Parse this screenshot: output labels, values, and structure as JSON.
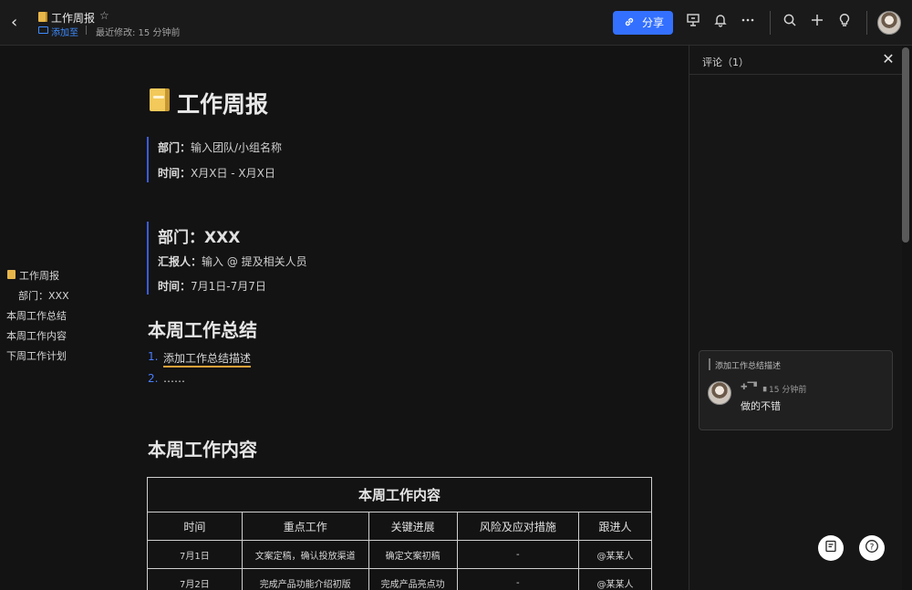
{
  "header": {
    "back_glyph": "‹",
    "title": "工作周报",
    "star_glyph": "☆",
    "add_to": "添加至",
    "modified": "最近修改: 15 分钟前",
    "share_label": "分享",
    "share_icon": "link-icon",
    "icons": [
      "presentation-icon",
      "bell-icon",
      "more-icon",
      "search-icon",
      "plus-icon",
      "lightbulb-icon"
    ]
  },
  "outline": {
    "items": [
      {
        "label": "工作周报"
      },
      {
        "label": "部门：XXX"
      },
      {
        "label": "本周工作总结"
      },
      {
        "label": "本周工作内容"
      },
      {
        "label": "下周工作计划"
      }
    ]
  },
  "doc": {
    "title": "工作周报",
    "meta": {
      "dept_label": "部门：",
      "dept_value": "输入团队/小组名称",
      "time_label": "时间：",
      "time_value": "X月X日 - X月X日"
    },
    "dept_heading": "部门：XXX",
    "reporter_label": "汇报人：",
    "reporter_value": "输入 @ 提及相关人员",
    "period_label": "时间：",
    "period_value": "7月1日-7月7日",
    "summary_heading": "本周工作总结",
    "summary_items": [
      {
        "num": "1.",
        "text": "添加工作总结描述"
      },
      {
        "num": "2.",
        "text": "……"
      }
    ],
    "content_heading": "本周工作内容",
    "table": {
      "caption": "本周工作内容",
      "headers": [
        "时间",
        "重点工作",
        "关键进展",
        "风险及应对措施",
        "跟进人"
      ],
      "rows": [
        [
          "7月1日",
          "文案定稿，确认投放渠道",
          "确定文案初稿",
          "-",
          "@某某人"
        ],
        [
          "7月2日",
          "完成产品功能介绍初版",
          "完成产品亮点功",
          "-",
          "@某某人"
        ]
      ]
    }
  },
  "comments": {
    "title": "评论（1）",
    "close_glyph": "✕",
    "card": {
      "quote": "添加工作总结描述",
      "user": "✚▔▘▗",
      "time": "15 分钟前",
      "text": "做的不错"
    }
  },
  "fabs": {
    "left_icon": "feedback-icon",
    "right_glyph": "?"
  },
  "colors": {
    "accent": "#3370ff",
    "quote_bar": "#3c5bd8",
    "list_number": "#4a7dff",
    "annotation_underline": "#e6a33a",
    "doc_icon": "#e7b64a"
  }
}
